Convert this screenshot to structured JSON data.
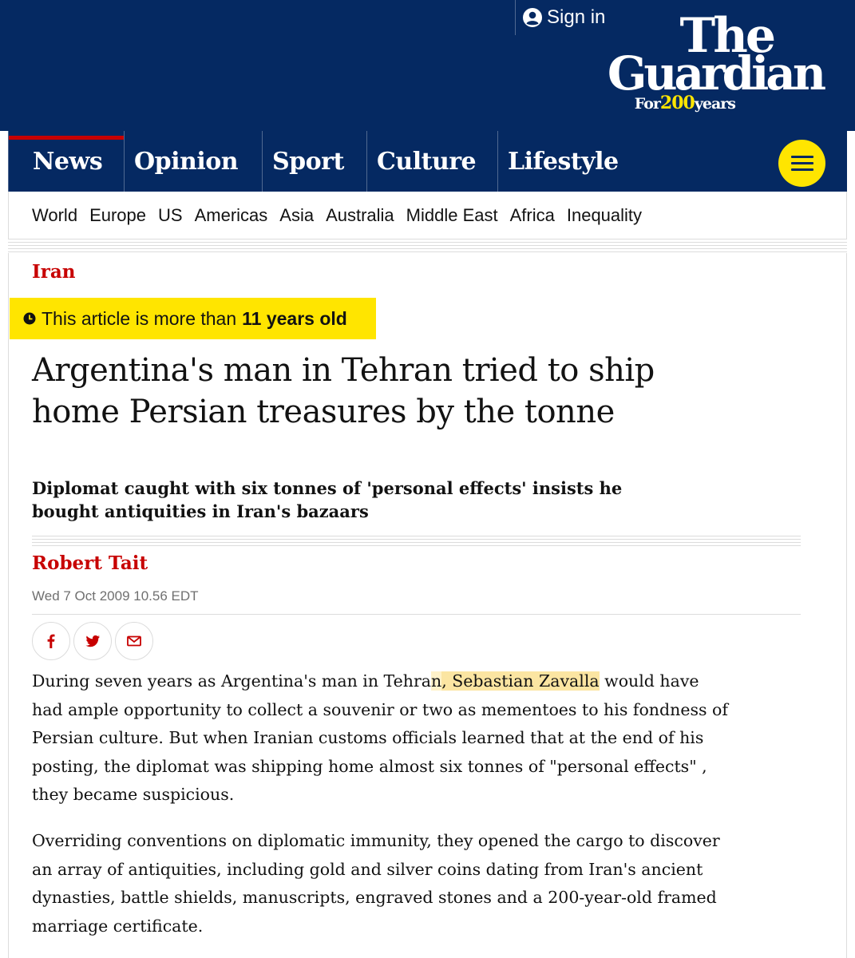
{
  "header": {
    "sign_in": "Sign in",
    "logo": {
      "line1": "The",
      "line2": "Guardian",
      "tag_for": "For",
      "tag_number": "200",
      "tag_years": "years"
    },
    "brand_color": "#052962",
    "highlight_color": "#ffe500",
    "news_accent": "#c70000"
  },
  "pillars": [
    {
      "label": "News",
      "active": true
    },
    {
      "label": "Opinion",
      "active": false
    },
    {
      "label": "Sport",
      "active": false
    },
    {
      "label": "Culture",
      "active": false
    },
    {
      "label": "Lifestyle",
      "active": false
    }
  ],
  "menu_icon": "hamburger-icon",
  "subnav": [
    "World",
    "Europe",
    "US",
    "Americas",
    "Asia",
    "Australia",
    "Middle East",
    "Africa",
    "Inequality"
  ],
  "article": {
    "section": "Iran",
    "age_notice": {
      "prefix": "This article is more than",
      "age": "11 years old",
      "icon": "clock-icon"
    },
    "headline": "Argentina's man in Tehran tried to ship home Persian treasures by the tonne",
    "standfirst": "Diplomat caught with six tonnes of 'personal effects' insists he bought antiquities in Iran's bazaars",
    "byline": "Robert Tait",
    "date": "Wed 7 Oct 2009 10.56 EDT",
    "share": [
      "facebook-icon",
      "twitter-icon",
      "email-icon"
    ],
    "paragraph1": {
      "before": "During seven years as Argentina's man in Tehra",
      "highlight_soft": "n",
      "highlight": ", Sebastian Zavalla",
      "after": " would have had ample opportunity to collect a souvenir or two as mementoes to his fondness of Persian culture. But when Iranian customs officials learned that at the end of his posting, the diplomat was shipping home almost six tonnes of \"personal effects\" , they became suspicious."
    },
    "paragraph2": "Overriding conventions on diplomatic immunity, they opened the cargo to discover an array of antiquities, including gold and silver coins dating from Iran's ancient dynasties, battle shields, manuscripts, engraved stones and a 200-year-old framed marriage certificate."
  }
}
